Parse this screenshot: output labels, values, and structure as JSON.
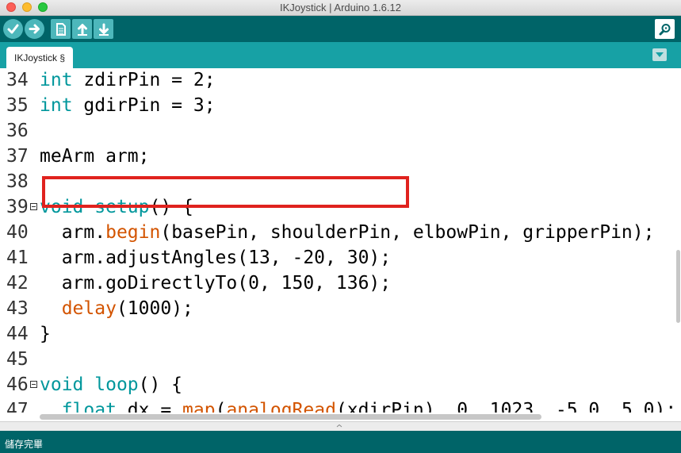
{
  "window": {
    "title": "IKJoystick | Arduino 1.6.12"
  },
  "toolbar": {
    "buttons": [
      {
        "name": "verify",
        "icon": "checkmark-icon"
      },
      {
        "name": "upload",
        "icon": "arrow-right-icon"
      },
      {
        "name": "new",
        "icon": "new-file-icon"
      },
      {
        "name": "open",
        "icon": "arrow-up-icon"
      },
      {
        "name": "save",
        "icon": "arrow-down-icon"
      },
      {
        "name": "serial-monitor",
        "icon": "magnifier-icon"
      }
    ]
  },
  "tabs": [
    {
      "label": "IKJoystick §"
    }
  ],
  "editor": {
    "lines": [
      {
        "number": "34",
        "segments": [
          {
            "t": "int",
            "c": "type"
          },
          {
            "t": " zdirPin = 2;",
            "c": "ident"
          }
        ]
      },
      {
        "number": "35",
        "segments": [
          {
            "t": "int",
            "c": "type"
          },
          {
            "t": " gdirPin = 3;",
            "c": "ident"
          }
        ]
      },
      {
        "number": "36",
        "segments": []
      },
      {
        "number": "37",
        "segments": [
          {
            "t": "meArm arm;",
            "c": "ident"
          }
        ]
      },
      {
        "number": "38",
        "segments": []
      },
      {
        "number": "39",
        "fold": true,
        "segments": [
          {
            "t": "void",
            "c": "type"
          },
          {
            "t": " ",
            "c": "ident"
          },
          {
            "t": "setup",
            "c": "type"
          },
          {
            "t": "() {",
            "c": "ident"
          }
        ]
      },
      {
        "number": "40",
        "segments": [
          {
            "t": "  arm.",
            "c": "ident"
          },
          {
            "t": "begin",
            "c": "func"
          },
          {
            "t": "(basePin, shoulderPin, elbowPin, gripperPin);",
            "c": "ident"
          }
        ]
      },
      {
        "number": "41",
        "segments": [
          {
            "t": "  arm.adjustAngles(13, -20, 30);",
            "c": "ident"
          }
        ]
      },
      {
        "number": "42",
        "segments": [
          {
            "t": "  arm.goDirectlyTo(0, 150, 136);",
            "c": "ident"
          }
        ]
      },
      {
        "number": "43",
        "segments": [
          {
            "t": "  ",
            "c": "ident"
          },
          {
            "t": "delay",
            "c": "func"
          },
          {
            "t": "(1000);",
            "c": "ident"
          }
        ]
      },
      {
        "number": "44",
        "segments": [
          {
            "t": "}",
            "c": "ident"
          }
        ]
      },
      {
        "number": "45",
        "segments": []
      },
      {
        "number": "46",
        "fold": true,
        "segments": [
          {
            "t": "void",
            "c": "type"
          },
          {
            "t": " ",
            "c": "ident"
          },
          {
            "t": "loop",
            "c": "type"
          },
          {
            "t": "() {",
            "c": "ident"
          }
        ]
      },
      {
        "number": "47",
        "segments": [
          {
            "t": "  ",
            "c": "ident"
          },
          {
            "t": "float",
            "c": "type"
          },
          {
            "t": " dx = ",
            "c": "ident"
          },
          {
            "t": "map",
            "c": "func"
          },
          {
            "t": "(",
            "c": "ident"
          },
          {
            "t": "analogRead",
            "c": "func"
          },
          {
            "t": "(xdirPin), 0, 1023, -5.0, 5.0);",
            "c": "ident"
          }
        ]
      }
    ]
  },
  "status": {
    "message": "儲存完畢"
  },
  "colors": {
    "toolbar": "#006468",
    "tabbar": "#17a1a5",
    "button": "#4db7bb",
    "keyword": "#00979c",
    "function": "#d35400",
    "highlight_box": "#e0221e"
  }
}
